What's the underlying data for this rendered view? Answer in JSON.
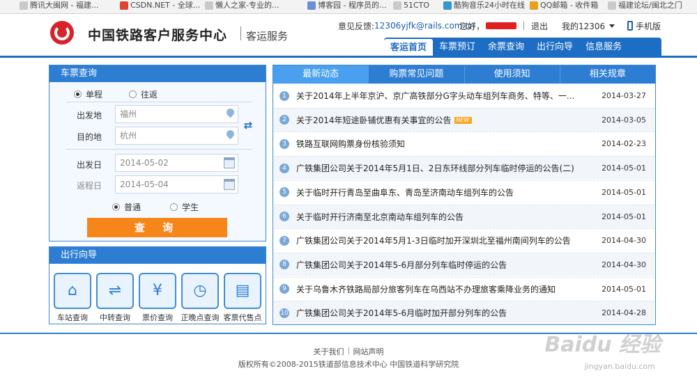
{
  "bookmarks": [
    "腾讯大闽网 - 福建...",
    "CSDN.NET - 全球...",
    "懒人之家-专业的...",
    "博客园 - 程序员的...",
    "51CTO",
    "酷狗音乐24小时在线",
    "QQ邮箱 - 收件箱",
    "福建论坛/闽北之门"
  ],
  "header": {
    "site_title": "中国铁路客户服务中心",
    "site_sub": "客运服务",
    "feedback_label": "意见反馈:",
    "feedback_email": "12306yjfk@rails.com.cn",
    "greeting": "您好，",
    "logout": "退出",
    "my_12306": "我的12306",
    "mobile": "手机版"
  },
  "nav": [
    "客运首页",
    "车票预订",
    "余票查询",
    "出行向导",
    "信息服务"
  ],
  "ticket_query": {
    "title": "车票查询",
    "trip_types": [
      "单程",
      "往返"
    ],
    "from_label": "出发地",
    "from_value": "福州",
    "to_label": "目的地",
    "to_value": "杭州",
    "depart_label": "出发日",
    "depart_value": "2014-05-02",
    "return_label": "返程日",
    "return_value": "2014-05-04",
    "passenger_types": [
      "普通",
      "学生"
    ],
    "query_button": "查 询"
  },
  "guide": {
    "title": "出行向导",
    "items": [
      "车站查询",
      "中转查询",
      "票价查询",
      "正晚点查询",
      "客票代售点"
    ]
  },
  "news": {
    "tabs": [
      "最新动态",
      "购票常见问题",
      "使用须知",
      "相关规章"
    ],
    "items": [
      {
        "num": "1",
        "title": "关于2014年上半年京沪、京广高铁部分G字头动车组列车商务、特等、一...",
        "date": "2014-03-27",
        "badge": ""
      },
      {
        "num": "2",
        "title": "关于2014年短途卧铺优惠有关事宜的公告",
        "date": "2014-03-05",
        "badge": "NEW"
      },
      {
        "num": "3",
        "title": "铁路互联网购票身份核验须知",
        "date": "2014-02-23",
        "badge": ""
      },
      {
        "num": "4",
        "title": "广铁集团公司关于2014年5月1日、2日东环线部分列车临时停运的公告(二)",
        "date": "2014-05-01",
        "badge": ""
      },
      {
        "num": "5",
        "title": "关于临时开行青岛至曲阜东、青岛至济南动车组列车的公告",
        "date": "2014-05-01",
        "badge": ""
      },
      {
        "num": "6",
        "title": "关于临时开行济南至北京南动车组列车的公告",
        "date": "2014-05-01",
        "badge": ""
      },
      {
        "num": "7",
        "title": "广铁集团公司关于2014年5月1-3日临时加开深圳北至福州南间列车的公告",
        "date": "2014-04-30",
        "badge": ""
      },
      {
        "num": "8",
        "title": "广铁集团公司关于2014年5-6月部分列车临时停运的公告",
        "date": "2014-04-30",
        "badge": ""
      },
      {
        "num": "9",
        "title": "关于乌鲁木齐铁路局部分旅客列车在乌西站不办理旅客乘降业务的通知",
        "date": "2014-05-01",
        "badge": ""
      },
      {
        "num": "10",
        "title": "广铁集团公司关于2014年5-6月临时加开部分列车的公告",
        "date": "2014-04-28",
        "badge": ""
      }
    ]
  },
  "footer": {
    "about": "关于我们",
    "statement": "网站声明",
    "copyright": "版权所有©2008-2015铁道部信息技术中心   中国铁道科学研究院"
  },
  "watermark": {
    "brand": "Baidu 经验",
    "url": "jingyan.baidu.com"
  }
}
